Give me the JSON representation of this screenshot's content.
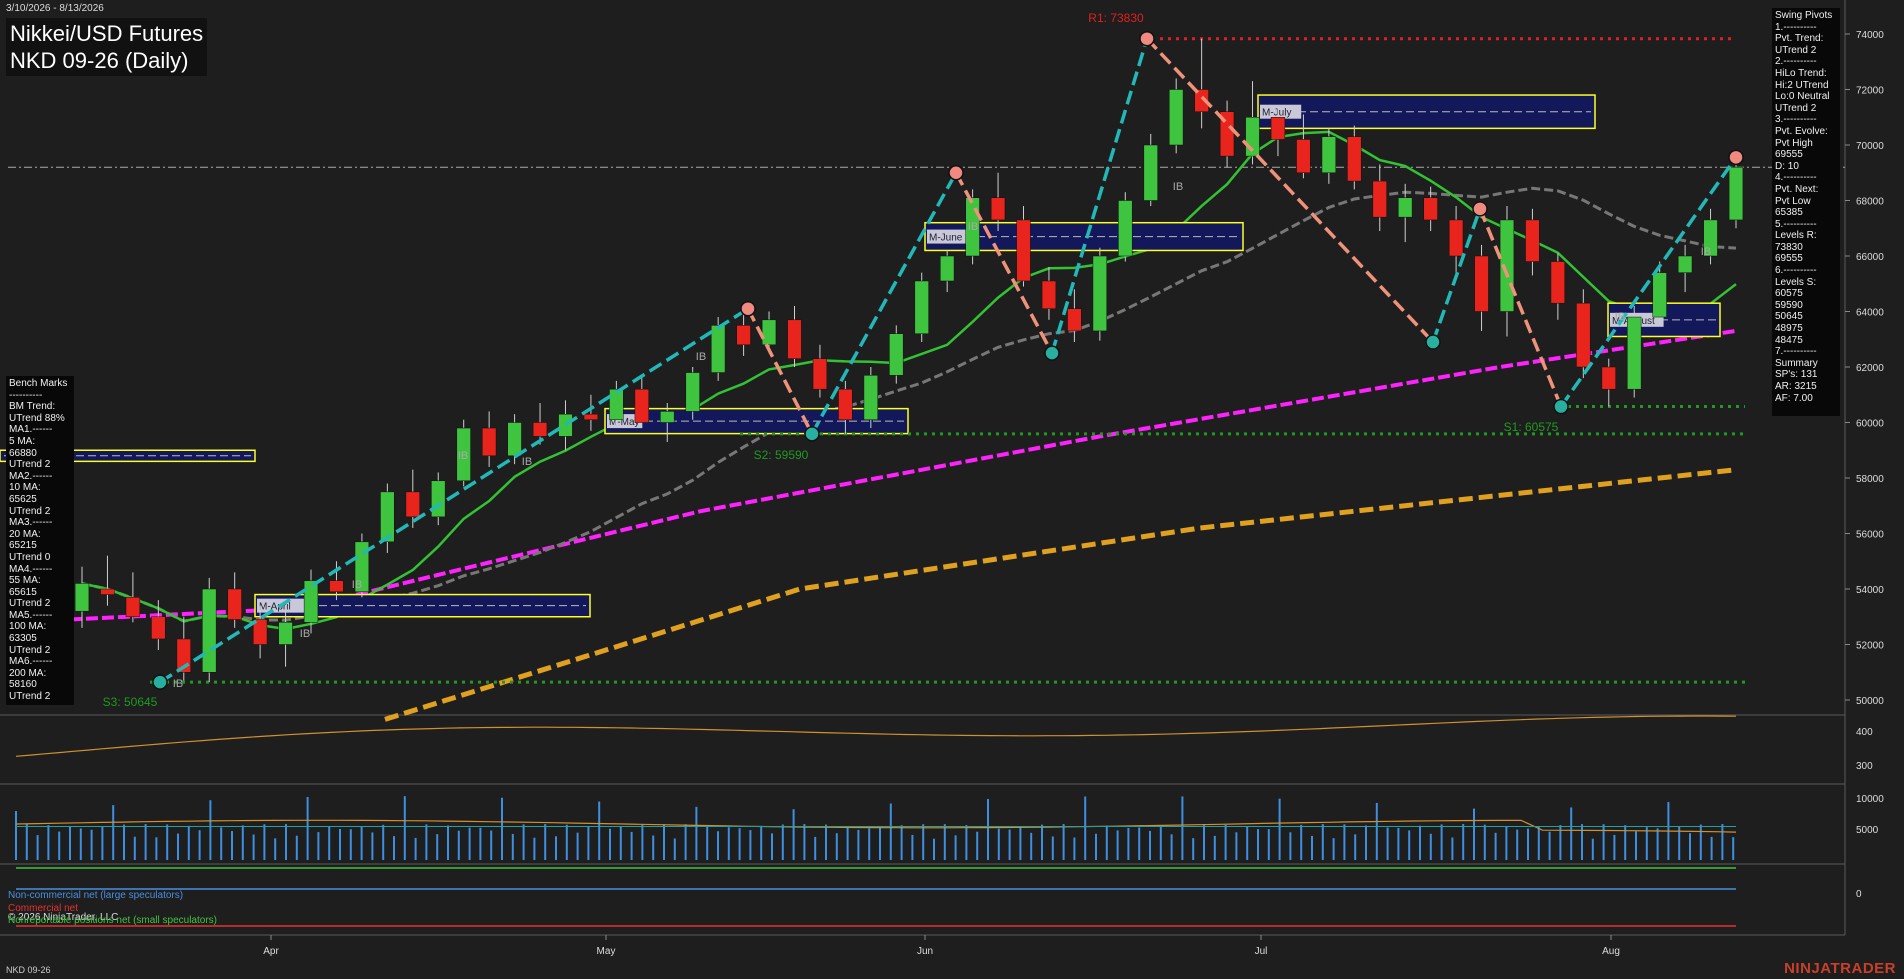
{
  "header": {
    "date_range": "3/10/2026 - 8/13/2026",
    "title_line1": "Nikkei/USD Futures",
    "title_line2": "NKD 09-26 (Daily)"
  },
  "chart_data": {
    "type": "candlestick",
    "x_labels": [
      "Apr",
      "May",
      "Jun",
      "Jul",
      "Aug"
    ],
    "y_ticks": [
      50000,
      52000,
      54000,
      56000,
      58000,
      60000,
      62000,
      64000,
      66000,
      68000,
      70000,
      72000,
      74000
    ],
    "ylim": [
      49000,
      75000
    ],
    "current_price_line": 69200,
    "candles_approx": [
      [
        53200,
        54800,
        52600,
        54200
      ],
      [
        54000,
        55200,
        53400,
        53800
      ],
      [
        53700,
        54600,
        52800,
        53000
      ],
      [
        53000,
        53600,
        51800,
        52200
      ],
      [
        52200,
        53000,
        50700,
        51000
      ],
      [
        51000,
        54400,
        50645,
        54000
      ],
      [
        54000,
        54600,
        52600,
        52900
      ],
      [
        52900,
        53400,
        51500,
        52000
      ],
      [
        52000,
        53200,
        51200,
        52800
      ],
      [
        52800,
        54700,
        52400,
        54300
      ],
      [
        54300,
        55000,
        53600,
        53900
      ],
      [
        53900,
        56000,
        53700,
        55700
      ],
      [
        55700,
        57800,
        55300,
        57500
      ],
      [
        57500,
        58300,
        56200,
        56600
      ],
      [
        56600,
        58200,
        56300,
        57900
      ],
      [
        57900,
        60100,
        57700,
        59800
      ],
      [
        59800,
        60400,
        58400,
        58800
      ],
      [
        58800,
        60300,
        58500,
        60000
      ],
      [
        60000,
        60700,
        59200,
        59500
      ],
      [
        59500,
        60800,
        59000,
        60300
      ],
      [
        60300,
        61000,
        59700,
        60100
      ],
      [
        60100,
        61500,
        59900,
        61200
      ],
      [
        61200,
        61600,
        59800,
        60000
      ],
      [
        60000,
        60700,
        59300,
        60400
      ],
      [
        60400,
        62000,
        60100,
        61800
      ],
      [
        61800,
        63800,
        61500,
        63500
      ],
      [
        63500,
        64200,
        62400,
        62800
      ],
      [
        62800,
        64000,
        62500,
        63700
      ],
      [
        63700,
        64200,
        62000,
        62300
      ],
      [
        62300,
        62800,
        60900,
        61200
      ],
      [
        61200,
        61500,
        59590,
        60100
      ],
      [
        60100,
        62000,
        59800,
        61700
      ],
      [
        61700,
        63500,
        61400,
        63200
      ],
      [
        63200,
        65400,
        62900,
        65100
      ],
      [
        65100,
        66200,
        64700,
        66000
      ],
      [
        66000,
        68400,
        65700,
        68100
      ],
      [
        68100,
        69000,
        66900,
        67300
      ],
      [
        67300,
        67800,
        64900,
        65100
      ],
      [
        65100,
        65600,
        63700,
        64100
      ],
      [
        64100,
        64800,
        62900,
        63300
      ],
      [
        63300,
        66300,
        62950,
        66000
      ],
      [
        66000,
        68300,
        65800,
        68000
      ],
      [
        68000,
        70400,
        67800,
        70000
      ],
      [
        70000,
        72400,
        69700,
        72000
      ],
      [
        72000,
        73830,
        70600,
        71200
      ],
      [
        71200,
        71600,
        69200,
        69600
      ],
      [
        69600,
        72300,
        69300,
        71000
      ],
      [
        71000,
        71400,
        69600,
        70200
      ],
      [
        70200,
        71100,
        68800,
        69000
      ],
      [
        69000,
        70600,
        68600,
        70300
      ],
      [
        70300,
        70700,
        68400,
        68700
      ],
      [
        68700,
        69300,
        66900,
        67400
      ],
      [
        67400,
        68600,
        66500,
        68100
      ],
      [
        68100,
        68500,
        66900,
        67300
      ],
      [
        67300,
        67800,
        65300,
        66000
      ],
      [
        66000,
        66400,
        63300,
        64000
      ],
      [
        64000,
        67800,
        63100,
        67300
      ],
      [
        67300,
        67700,
        65300,
        65800
      ],
      [
        65800,
        66100,
        63700,
        64300
      ],
      [
        64300,
        64800,
        61600,
        62000
      ],
      [
        62000,
        62300,
        60575,
        61200
      ],
      [
        61200,
        64200,
        60900,
        63800
      ],
      [
        63800,
        65800,
        63500,
        65400
      ],
      [
        65400,
        66400,
        64700,
        66000
      ],
      [
        66000,
        67700,
        65700,
        67300
      ],
      [
        67300,
        69555,
        67000,
        69200
      ]
    ],
    "ma_labels": [
      "5 MA",
      "10 MA",
      "20 MA",
      "55 MA",
      "100 MA",
      "200 MA"
    ],
    "swing_points": [
      {
        "date": "mid-Mar",
        "value": 50645,
        "type": "low"
      },
      {
        "date": "mid-May",
        "value": 64100,
        "type": "high"
      },
      {
        "date": "late-May",
        "value": 59590,
        "type": "low"
      },
      {
        "date": "early-Jun",
        "value": 69000,
        "type": "high"
      },
      {
        "date": "mid-Jun",
        "value": 62500,
        "type": "low"
      },
      {
        "date": "late-Jun",
        "value": 73830,
        "type": "high"
      },
      {
        "date": "late-Jul",
        "value": 62900,
        "type": "low"
      },
      {
        "date": "late-Jul",
        "value": 67700,
        "type": "high"
      },
      {
        "date": "early-Aug",
        "value": 60575,
        "type": "low"
      },
      {
        "date": "mid-Aug",
        "value": 69555,
        "type": "high"
      }
    ],
    "levels": {
      "r1": {
        "label": "R1: 73830",
        "value": 73830
      },
      "s1": {
        "label": "S1: 60575",
        "value": 60575
      },
      "s2": {
        "label": "S2: 59590",
        "value": 59590
      },
      "s3": {
        "label": "S3: 50645",
        "value": 50645
      }
    },
    "value_areas": [
      {
        "label": "M-April",
        "low": 53000,
        "high": 53800
      },
      {
        "label": "M-May",
        "low": 59600,
        "high": 60500
      },
      {
        "label": "M-June",
        "low": 66200,
        "high": 67200
      },
      {
        "label": "M-July",
        "low": 70600,
        "high": 71800
      },
      {
        "label": "M-August",
        "low": 63100,
        "high": 64300
      },
      {
        "label": "",
        "low": 58600,
        "high": 59000
      }
    ],
    "ib_labels": [
      "IB",
      "IB",
      "IB",
      "IB",
      "IB",
      "IB",
      "IB",
      "IB",
      "IB",
      "IB",
      "IB"
    ],
    "sub1_ticks": [
      300,
      400
    ],
    "sub2_ticks": [
      5000,
      10000
    ],
    "sub3_ticks": [
      0
    ]
  },
  "benchmarks": {
    "lines": [
      "Bench Marks",
      "----------",
      "BM Trend:",
      "UTrend 88%",
      "MA1.------",
      "5 MA:",
      "66880",
      "UTrend 2",
      "MA2.------",
      "10 MA:",
      "65625",
      "UTrend 2",
      "MA3.------",
      "20 MA:",
      "65215",
      "UTrend 0",
      "MA4.------",
      "55 MA:",
      "65615",
      "UTrend 2",
      "MA5.------",
      "100 MA:",
      "63305",
      "UTrend 2",
      "MA6.------",
      "200 MA:",
      "58160",
      "UTrend 2"
    ]
  },
  "swing_panel": {
    "lines": [
      "Swing Pivots",
      "1.----------",
      "Pvt. Trend:",
      "UTrend 2",
      "2.----------",
      "HiLo Trend:",
      "Hi:2 UTrend",
      "Lo:0 Neutral",
      "UTrend 2",
      "3.----------",
      "Pvt. Evolve:",
      "Pvt High",
      "69555",
      "D: 10",
      "4.----------",
      "Pvt. Next:",
      "Pvt Low",
      "65385",
      "5.----------",
      "Levels R:",
      "73830",
      "69555",
      "6.----------",
      "Levels S:",
      "60575",
      "59590",
      "50645",
      "48975",
      "48475",
      "7.----------",
      "Summary",
      "SP's: 131",
      "AR: 3215",
      "AF: 7.00"
    ]
  },
  "cot_legend": {
    "noncommercial": "Non-commercial net (large speculators)",
    "commercial": "Commercial net",
    "copyright": "© 2026 NinjaTrader, LLC",
    "small": "Nonreportable positions net (small speculators)"
  },
  "footer": {
    "symbol": "NKD 09-26",
    "brand": "NINJATRADER"
  },
  "colors": {
    "up": "#3ec43e",
    "down": "#e8241c",
    "ma_fast": "#33c233",
    "ma_mid": "#777777",
    "ma_magenta": "#ff22ff",
    "ma_orange": "#e0a020",
    "pivot_up": "#22b8b8",
    "pivot_down": "#f0927a",
    "value_area": "#12185a",
    "value_area_border": "#ffff22"
  }
}
